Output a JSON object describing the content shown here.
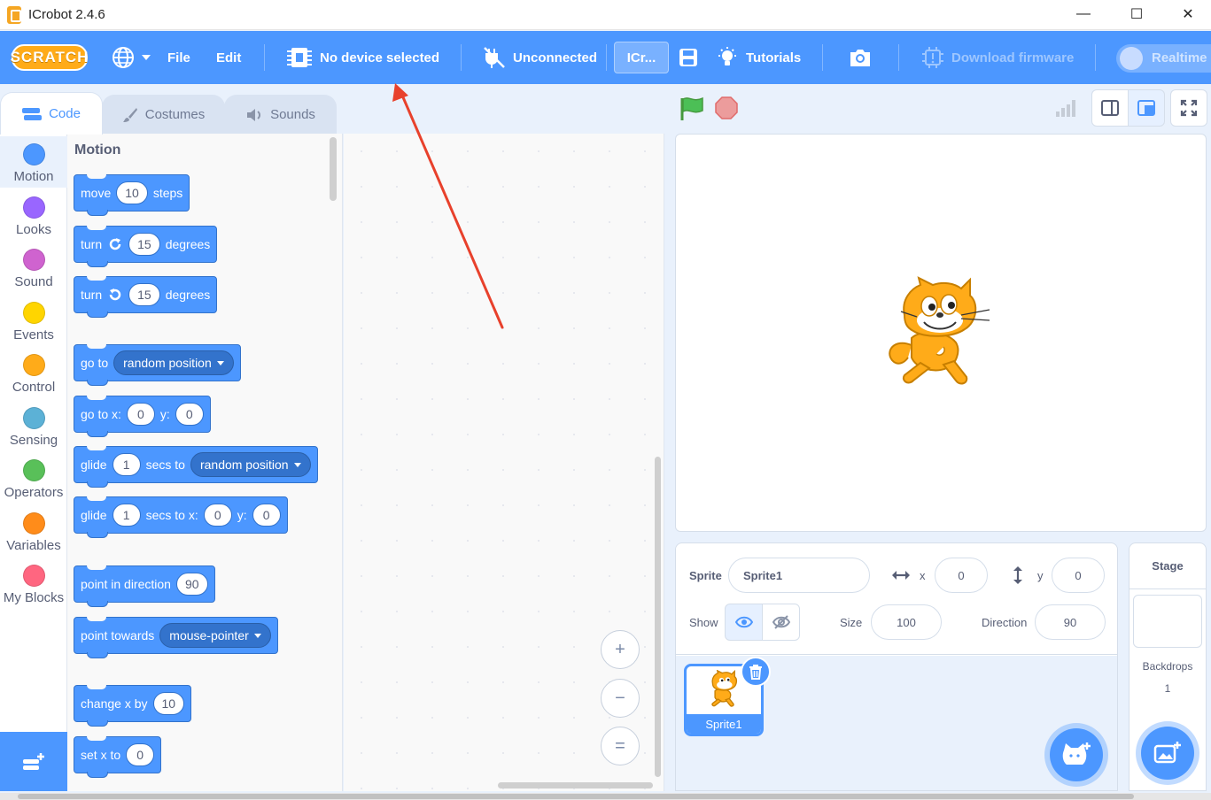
{
  "window": {
    "title": "ICrobot 2.4.6",
    "minimize": "—",
    "maximize": "☐",
    "close": "✕"
  },
  "menubar": {
    "logo": "SCRATCH",
    "file": "File",
    "edit": "Edit",
    "device": "No device selected",
    "connection": "Unconnected",
    "project_title": "ICr...",
    "tutorials": "Tutorials",
    "download_firmware": "Download firmware",
    "realtime": "Realtime"
  },
  "tabs": {
    "code": "Code",
    "costumes": "Costumes",
    "sounds": "Sounds"
  },
  "categories": [
    {
      "label": "Motion",
      "color": "#4c97ff"
    },
    {
      "label": "Looks",
      "color": "#9966ff"
    },
    {
      "label": "Sound",
      "color": "#cf63cf"
    },
    {
      "label": "Events",
      "color": "#ffd500"
    },
    {
      "label": "Control",
      "color": "#ffab19"
    },
    {
      "label": "Sensing",
      "color": "#5cb1d6"
    },
    {
      "label": "Operators",
      "color": "#59c059"
    },
    {
      "label": "Variables",
      "color": "#ff8c1a"
    },
    {
      "label": "My Blocks",
      "color": "#ff6680"
    }
  ],
  "palette": {
    "heading": "Motion",
    "blocks": {
      "move": {
        "t1": "move",
        "v1": "10",
        "t2": "steps"
      },
      "turn_right": {
        "t1": "turn",
        "v1": "15",
        "t2": "degrees"
      },
      "turn_left": {
        "t1": "turn",
        "v1": "15",
        "t2": "degrees"
      },
      "goto": {
        "t1": "go to",
        "d1": "random position"
      },
      "goto_xy": {
        "t1": "go to x:",
        "v1": "0",
        "t2": "y:",
        "v2": "0"
      },
      "glide": {
        "t1": "glide",
        "v1": "1",
        "t2": "secs to",
        "d1": "random position"
      },
      "glide_xy": {
        "t1": "glide",
        "v1": "1",
        "t2": "secs to x:",
        "v2": "0",
        "t3": "y:",
        "v3": "0"
      },
      "point_dir": {
        "t1": "point in direction",
        "v1": "90"
      },
      "point_towards": {
        "t1": "point towards",
        "d1": "mouse-pointer"
      },
      "change_x": {
        "t1": "change x by",
        "v1": "10"
      },
      "set_x": {
        "t1": "set x to",
        "v1": "0"
      }
    }
  },
  "zoom": {
    "zoom_in": "+",
    "zoom_out": "−",
    "reset": "="
  },
  "sprite_info": {
    "sprite_label": "Sprite",
    "sprite_name": "Sprite1",
    "x_label": "x",
    "x_value": "0",
    "y_label": "y",
    "y_value": "0",
    "show_label": "Show",
    "size_label": "Size",
    "size_value": "100",
    "direction_label": "Direction",
    "direction_value": "90"
  },
  "sprites": [
    {
      "name": "Sprite1"
    }
  ],
  "stage_selector": {
    "title": "Stage",
    "backdrops_label": "Backdrops",
    "backdrops_count": "1"
  },
  "colors": {
    "accent": "#4c97ff",
    "annotation": "#e8412c"
  }
}
